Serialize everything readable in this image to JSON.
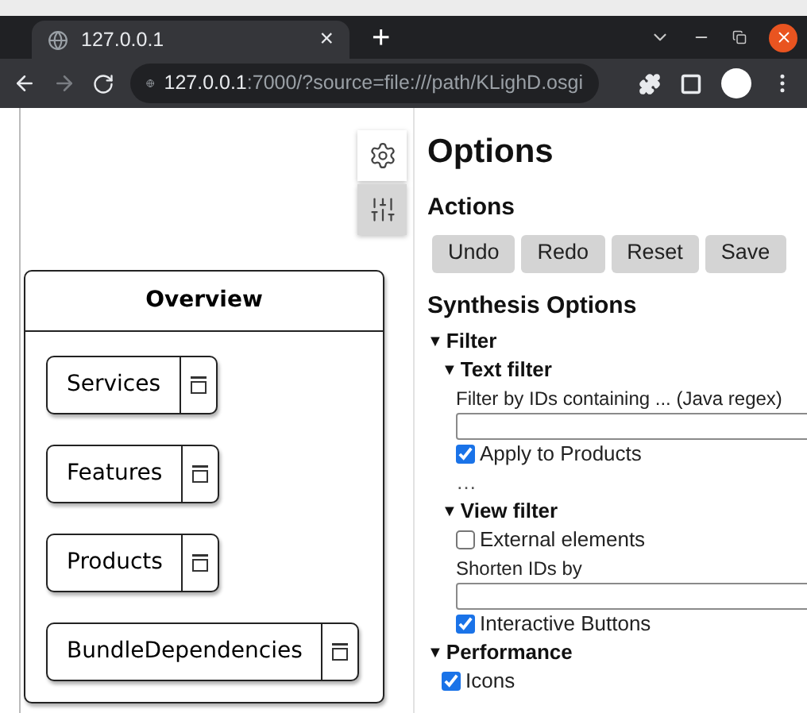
{
  "browser": {
    "tab_title": "127.0.0.1",
    "tab_close": "×",
    "new_tab": "+",
    "url_host": "127.0.0.1",
    "url_rest": ":7000/?source=file:///path/KLighD.osgi"
  },
  "sidebar": {
    "buttons": [
      {
        "kind": "gear",
        "selected": false
      },
      {
        "kind": "sliders",
        "selected": true
      }
    ]
  },
  "diagram": {
    "title": "Overview",
    "nodes": [
      {
        "label": "Services"
      },
      {
        "label": "Features"
      },
      {
        "label": "Products"
      },
      {
        "label": "BundleDependencies"
      }
    ]
  },
  "options": {
    "title": "Options",
    "actions_heading": "Actions",
    "actions": [
      "Undo",
      "Redo",
      "Reset",
      "Save"
    ],
    "synthesis_heading": "Synthesis Options",
    "sections": [
      {
        "marker": "▼",
        "title": "Filter",
        "expanded": true,
        "children": [
          {
            "marker": "▼",
            "title": "Text filter",
            "expanded": true,
            "items": [
              {
                "kind": "textfield",
                "label": "Filter by IDs containing ... (Java regex)"
              },
              {
                "kind": "checkbox",
                "label": "Apply to Products",
                "checked": true
              },
              {
                "kind": "ellipsis",
                "label": "…"
              }
            ]
          },
          {
            "marker": "▼",
            "title": "View filter",
            "expanded": true,
            "items": [
              {
                "kind": "checkbox",
                "label": "External elements",
                "checked": false
              },
              {
                "kind": "textfield",
                "label": "Shorten IDs by"
              },
              {
                "kind": "checkbox",
                "label": "Interactive Buttons",
                "checked": true
              }
            ]
          }
        ]
      },
      {
        "marker": "▼",
        "title": "Performance",
        "expanded": true,
        "items": [
          {
            "kind": "checkbox",
            "label": "Icons",
            "checked": true
          }
        ]
      }
    ]
  }
}
